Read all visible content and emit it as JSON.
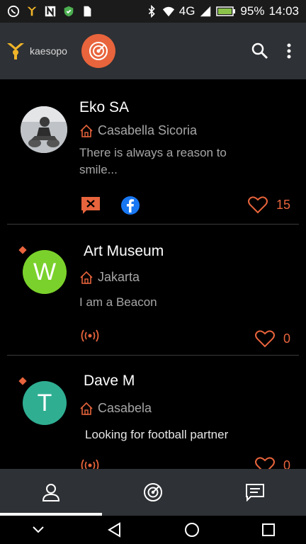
{
  "status_bar": {
    "network": "4G",
    "battery": "95%",
    "time": "14:03"
  },
  "app": {
    "logo_text": "kaesopo"
  },
  "feed": [
    {
      "name": "Eko SA",
      "location": "Casabella Sicoria",
      "bio": "There is always a reason to smile...",
      "likes": "15",
      "avatar_type": "photo"
    },
    {
      "name": "Art Museum",
      "location": "Jakarta",
      "bio": "I am a Beacon",
      "likes": "0",
      "avatar_letter": "W",
      "avatar_color": "#7bd12b"
    },
    {
      "name": "Dave M",
      "location": "Casabela",
      "bio": "Looking for football partner",
      "likes": "0",
      "avatar_letter": "T",
      "avatar_color": "#2fae92"
    }
  ],
  "colors": {
    "accent": "#e8643c",
    "appbar": "#2e3135"
  },
  "bottom_nav": {
    "tabs": [
      "profile-icon",
      "radar-icon",
      "chat-icon"
    ],
    "active": 0
  }
}
